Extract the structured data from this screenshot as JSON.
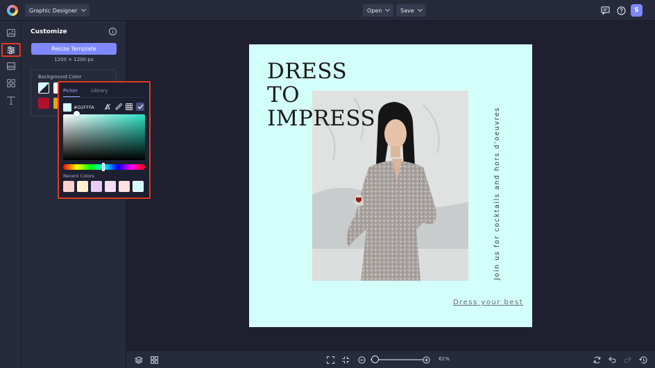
{
  "topbar": {
    "workspace_label": "Graphic Designer",
    "open_label": "Open",
    "save_label": "Save",
    "avatar_initial": "S"
  },
  "rail": {
    "items": [
      "image-icon",
      "sliders-icon",
      "layout-icon",
      "elements-icon",
      "text-icon"
    ],
    "active": "sliders-icon"
  },
  "customize": {
    "title": "Customize",
    "resize_label": "Resize Template",
    "size_text": "1200 × 1200 px",
    "background_color_label": "Background Color",
    "swatches": [
      "#D2FFFA",
      "#FFFFFF",
      "#B2102F",
      "#E8A317"
    ]
  },
  "picker": {
    "tab_picker": "Picker",
    "tab_library": "Library",
    "hex_value": "#D2FFFA",
    "recent_label": "Recent Colors",
    "recent_colors": [
      "#F9D3CB",
      "#FFF1D1",
      "#E8CCF7",
      "#F6DEF5",
      "#FDE3E0",
      "#D2FFFA"
    ]
  },
  "design": {
    "headline_1": "DRESS",
    "headline_2": "TO",
    "headline_3": "IMPRESS",
    "tagline": "Join us for cocktails and hors d'oeuvres",
    "cta": "Dress your best",
    "background": "#D2FFFA"
  },
  "zoom": {
    "percent": "61%"
  },
  "colors": {
    "accent": "#7F88FF",
    "highlight_border": "#E23A1F"
  }
}
